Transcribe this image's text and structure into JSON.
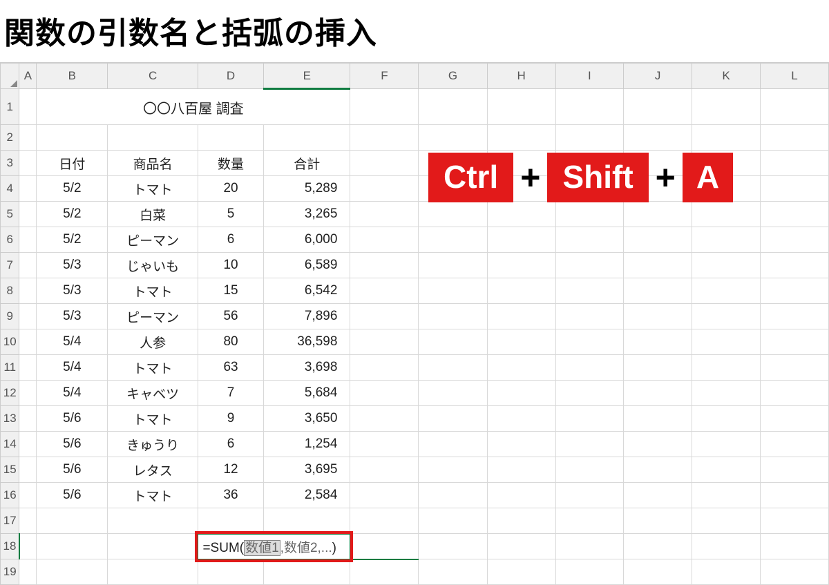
{
  "title": "関数の引数名と括弧の挿入",
  "columnHeaders": [
    "A",
    "B",
    "C",
    "D",
    "E",
    "F",
    "G",
    "H",
    "I",
    "J",
    "K",
    "L"
  ],
  "rowHeaders": [
    "1",
    "2",
    "3",
    "4",
    "5",
    "6",
    "7",
    "8",
    "9",
    "10",
    "11",
    "12",
    "13",
    "14",
    "15",
    "16",
    "17",
    "18",
    "19"
  ],
  "activeColumn": "E",
  "activeRow": "18",
  "mergedTitle": "〇〇八百屋 調査",
  "headers": {
    "date": "日付",
    "product": "商品名",
    "qty": "数量",
    "total": "合計"
  },
  "rows": [
    {
      "date": "5/2",
      "product": "トマト",
      "qty": "20",
      "total": "5,289"
    },
    {
      "date": "5/2",
      "product": "白菜",
      "qty": "5",
      "total": "3,265"
    },
    {
      "date": "5/2",
      "product": "ピーマン",
      "qty": "6",
      "total": "6,000"
    },
    {
      "date": "5/3",
      "product": "じゃいも",
      "qty": "10",
      "total": "6,589"
    },
    {
      "date": "5/3",
      "product": "トマト",
      "qty": "15",
      "total": "6,542"
    },
    {
      "date": "5/3",
      "product": "ピーマン",
      "qty": "56",
      "total": "7,896"
    },
    {
      "date": "5/4",
      "product": "人参",
      "qty": "80",
      "total": "36,598"
    },
    {
      "date": "5/4",
      "product": "トマト",
      "qty": "63",
      "total": "3,698"
    },
    {
      "date": "5/4",
      "product": "キャベツ",
      "qty": "7",
      "total": "5,684"
    },
    {
      "date": "5/6",
      "product": "トマト",
      "qty": "9",
      "total": "3,650"
    },
    {
      "date": "5/6",
      "product": "きゅうり",
      "qty": "6",
      "total": "1,254"
    },
    {
      "date": "5/6",
      "product": "レタス",
      "qty": "12",
      "total": "3,695"
    },
    {
      "date": "5/6",
      "product": "トマト",
      "qty": "36",
      "total": "2,584"
    }
  ],
  "formula": {
    "prefix": "=SUM(",
    "arg1": "数値1",
    "sep1": ",",
    "arg2": "数値2",
    "sep2": ",",
    "arg3": "...",
    "suffix": ")"
  },
  "shortcut": {
    "k1": "Ctrl",
    "plus": "+",
    "k2": "Shift",
    "k3": "A"
  }
}
